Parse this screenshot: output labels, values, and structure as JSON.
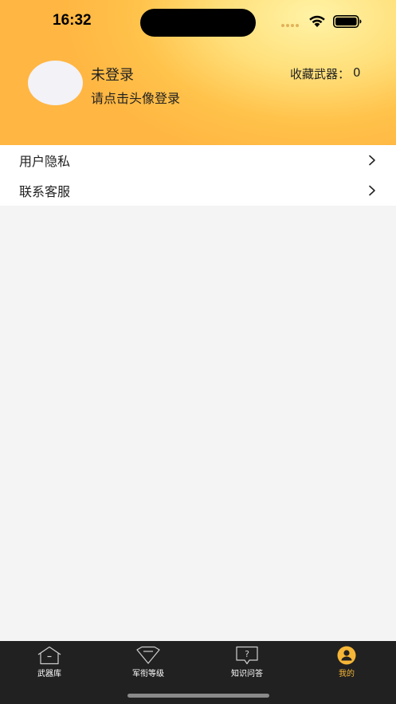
{
  "status_bar": {
    "time": "16:32"
  },
  "profile": {
    "title": "未登录",
    "hint": "请点击头像登录",
    "favorites_label": "收藏武器：",
    "favorites_count": "0"
  },
  "menu": {
    "items": [
      {
        "label": "用户隐私",
        "icon": "chevron-right-icon"
      },
      {
        "label": "联系客服",
        "icon": "chevron-right-icon"
      }
    ]
  },
  "tabbar": {
    "tabs": [
      {
        "label": "武器库",
        "icon": "house-icon"
      },
      {
        "label": "军衔等级",
        "icon": "diamond-icon"
      },
      {
        "label": "知识问答",
        "icon": "question-bubble-icon"
      },
      {
        "label": "我的",
        "icon": "user-circle-icon",
        "active": true
      }
    ]
  },
  "colors": {
    "accent": "#f6b637",
    "tabbar_bg": "#212121",
    "header_light": "#fff3a6",
    "header_dark": "#ffb642"
  }
}
